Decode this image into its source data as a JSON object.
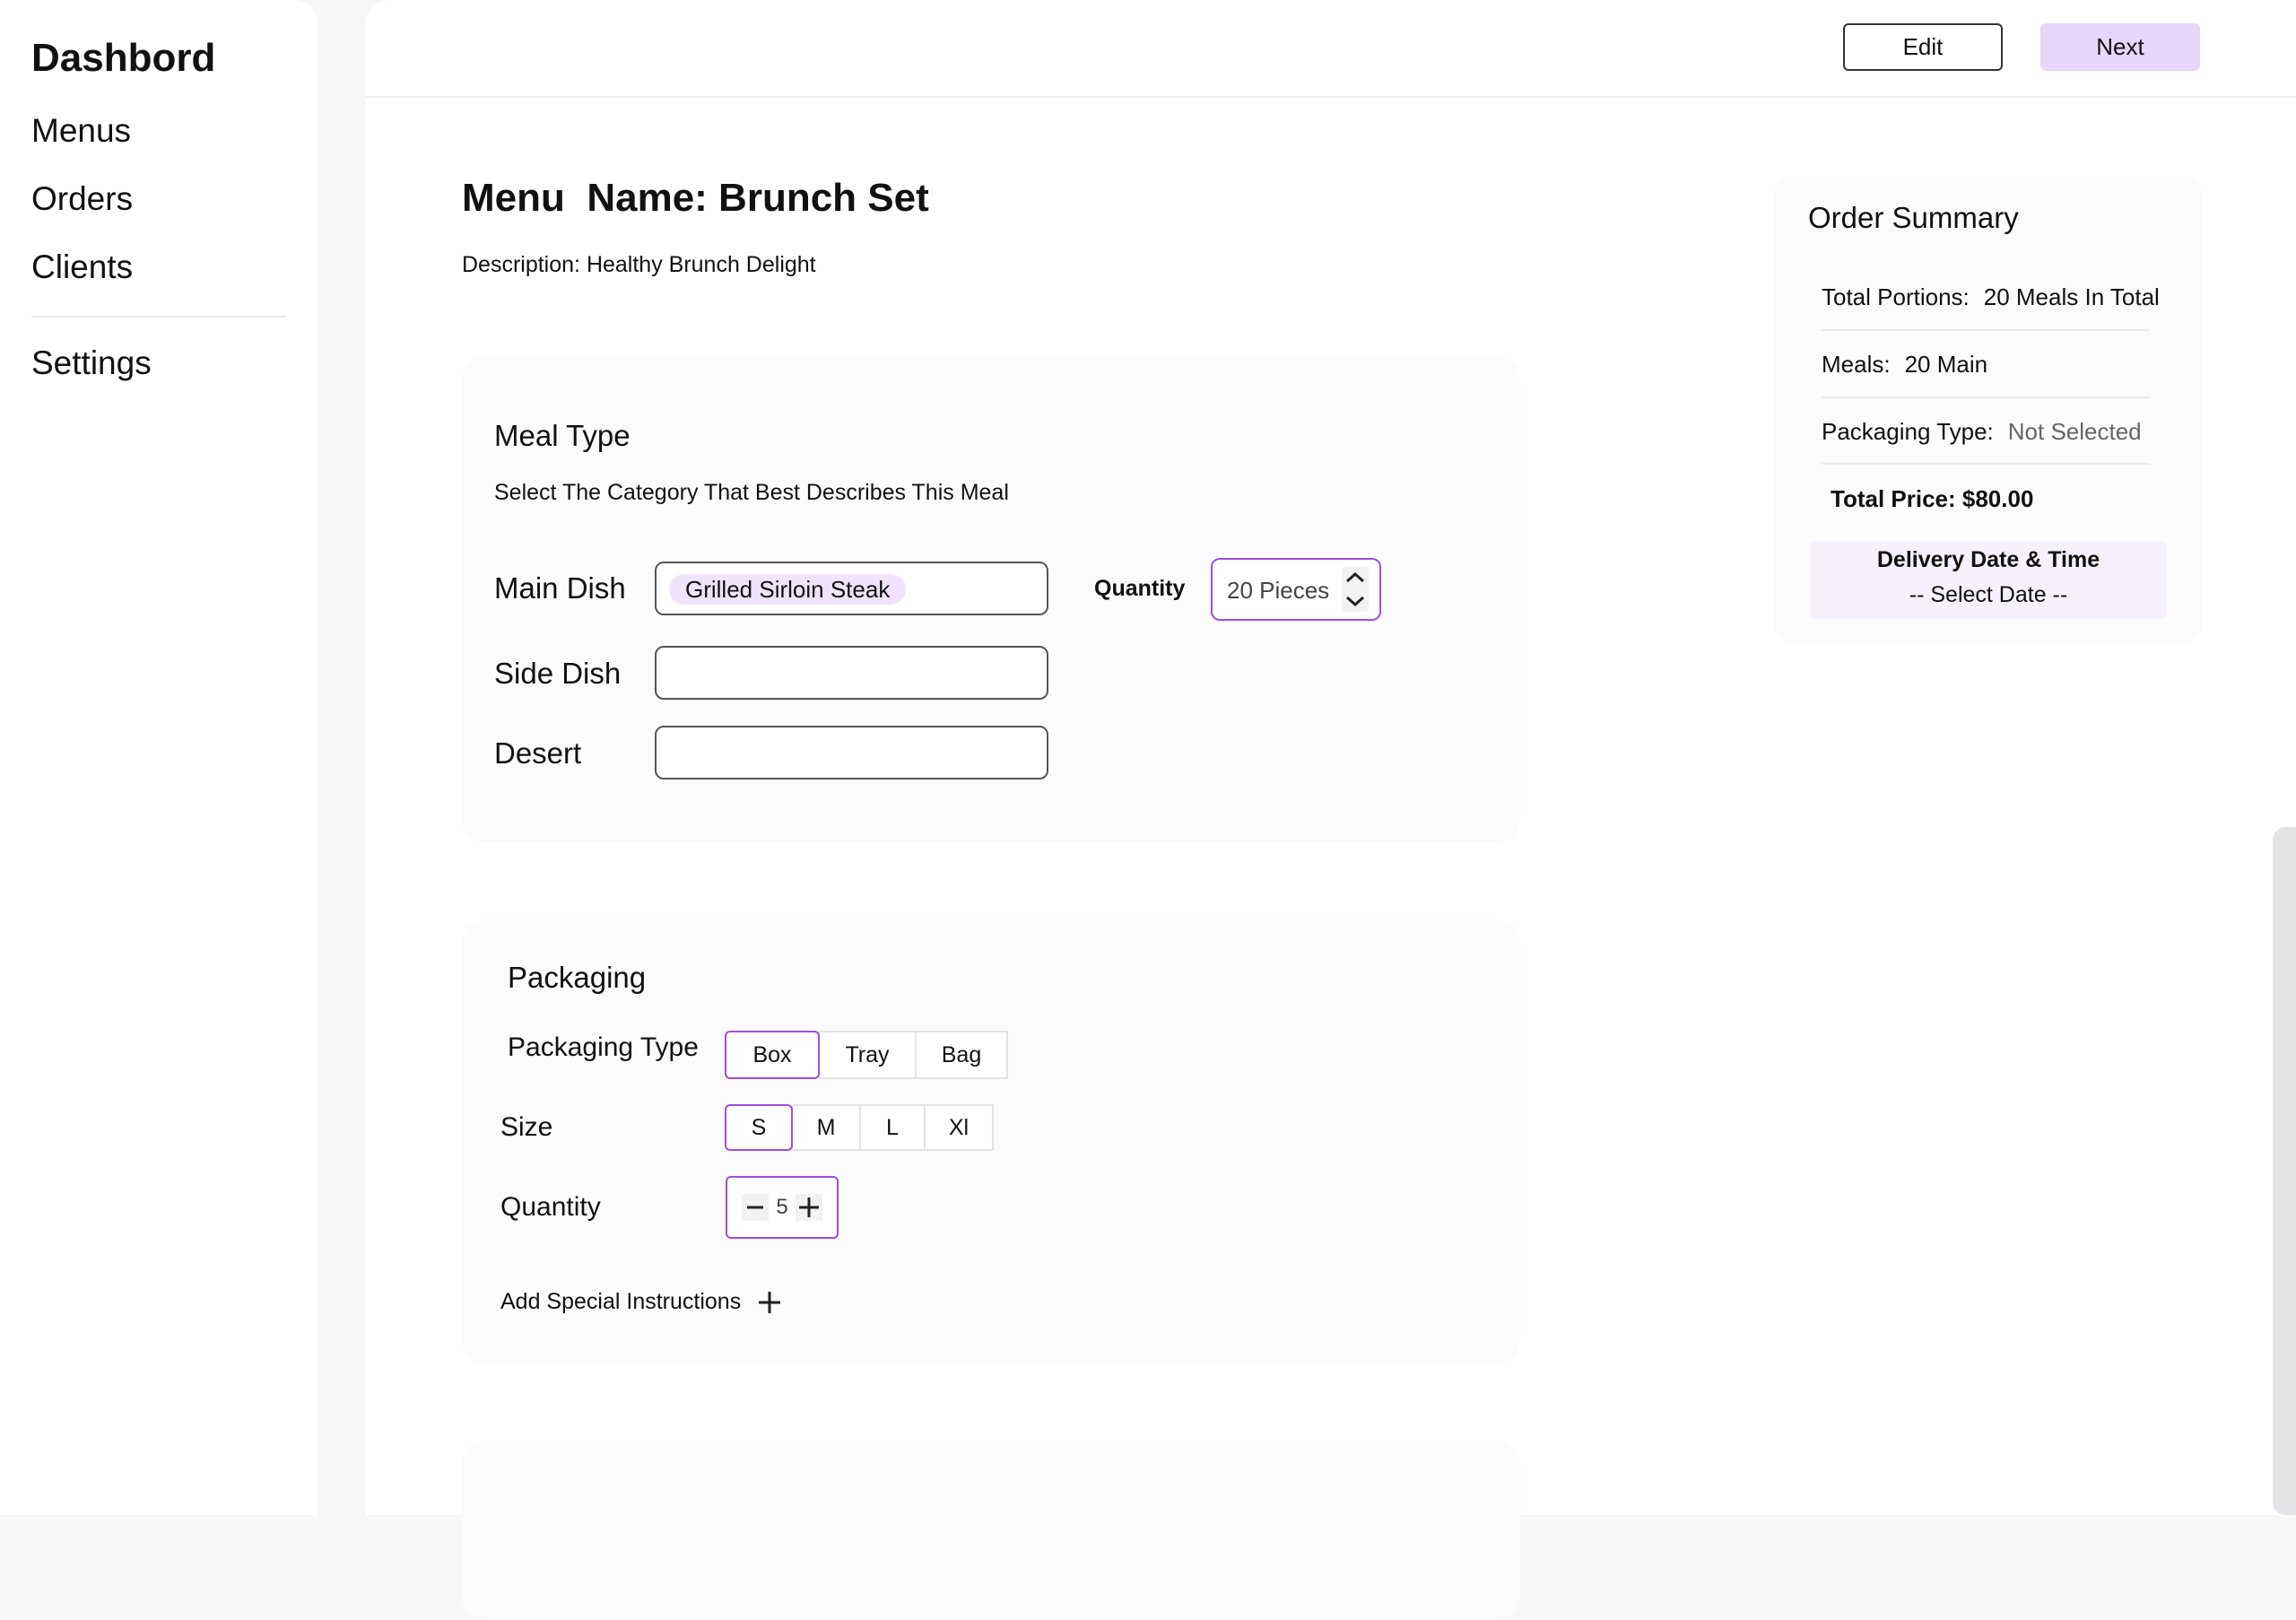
{
  "sidebar": {
    "title": "Dashbord",
    "items": [
      "Menus",
      "Orders",
      "Clients"
    ],
    "settings": "Settings"
  },
  "toolbar": {
    "edit_label": "Edit",
    "next_label": "Next"
  },
  "menu": {
    "title": "Menu  Name: Brunch Set",
    "description": "Description: Healthy Brunch Delight"
  },
  "meal_type": {
    "title": "Meal Type",
    "subtitle": "Select The Category That Best Describes This Meal",
    "main_dish_label": "Main Dish",
    "main_dish_value": "Grilled Sirloin Steak",
    "side_dish_label": "Side Dish",
    "side_dish_value": "",
    "desert_label": "Desert",
    "desert_value": "",
    "quantity_label": "Quantity",
    "quantity_value": "20 Pieces"
  },
  "packaging": {
    "title": "Packaging",
    "type_label": "Packaging Type",
    "types": [
      "Box",
      "Tray",
      "Bag"
    ],
    "selected_type": "Box",
    "size_label": "Size",
    "sizes": [
      "S",
      "M",
      "L",
      "Xl"
    ],
    "selected_size": "S",
    "quantity_label": "Quantity",
    "quantity_value": "5",
    "special_instructions": "Add Special Instructions"
  },
  "summary": {
    "title": "Order Summary",
    "total_portions_label": "Total Portions:",
    "total_portions_value": "20 Meals In Total",
    "meals_label": "Meals:",
    "meals_value": "20 Main",
    "packaging_type_label": "Packaging Type:",
    "packaging_type_value": "Not Selected",
    "total_price": "Total Price: $80.00",
    "delivery_title": "Delivery Date & Time",
    "delivery_value": "-- Select Date --"
  },
  "colors": {
    "accent": "#9b4fe0",
    "next_button": "#e7d7fa",
    "chip": "#efe4fb"
  }
}
